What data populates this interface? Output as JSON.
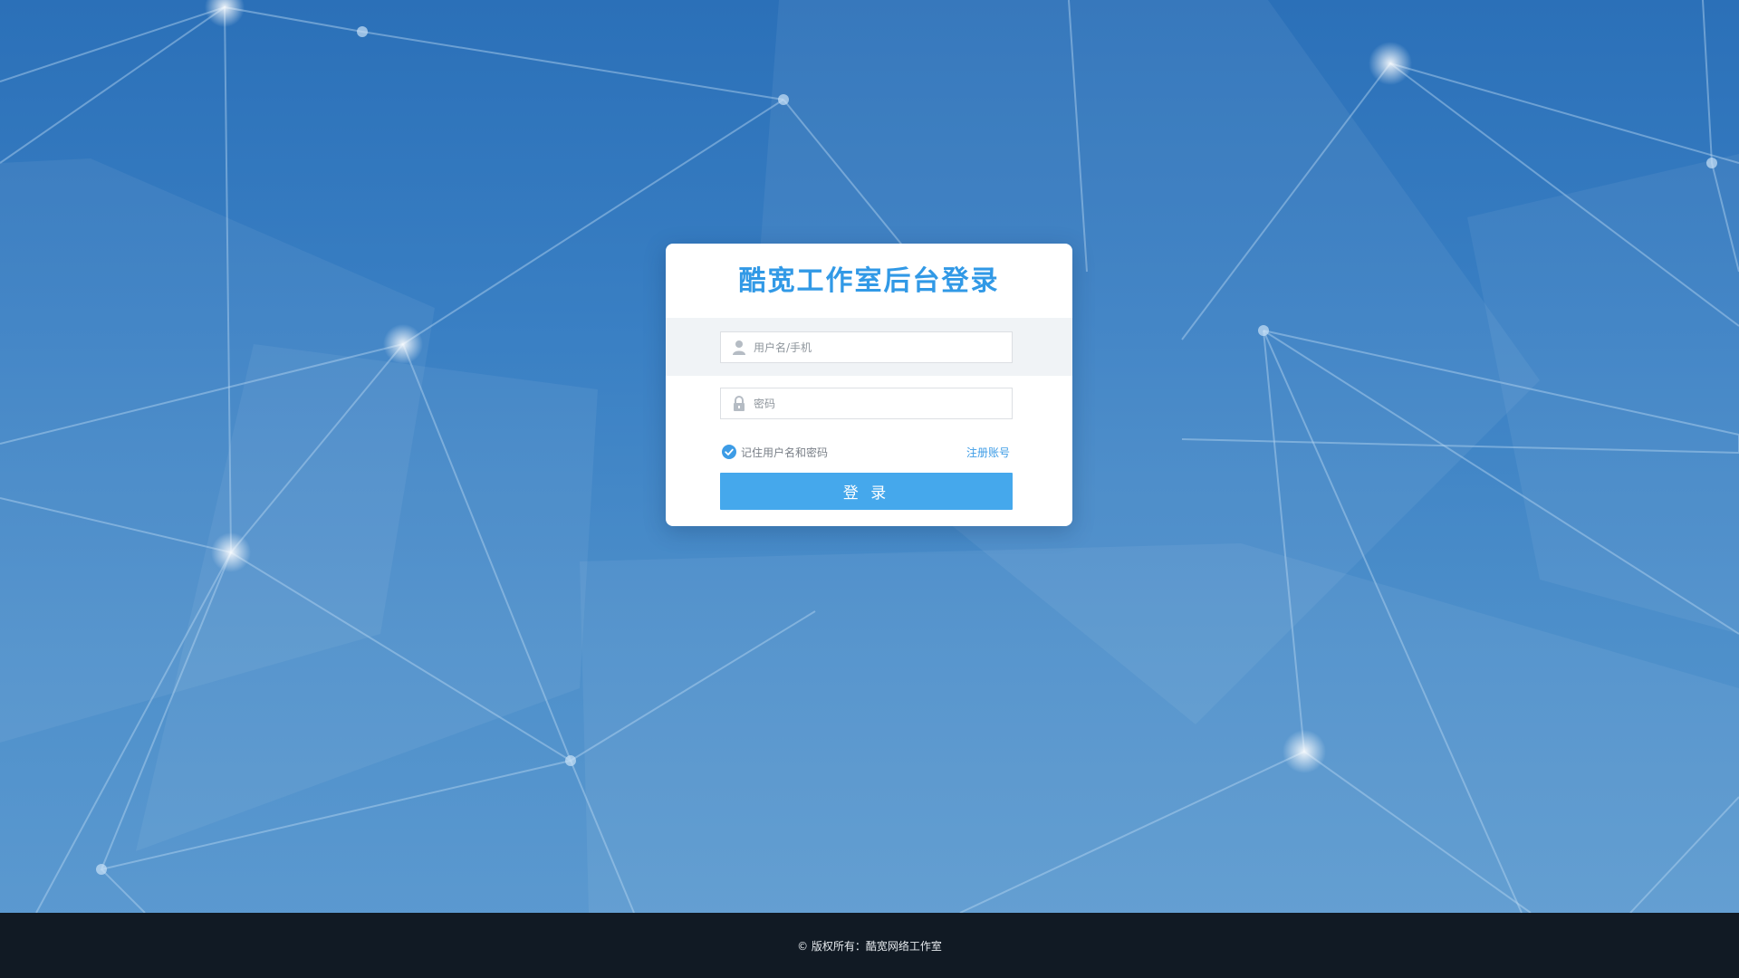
{
  "login": {
    "title": "酷宽工作室后台登录",
    "username_placeholder": "用户名/手机",
    "password_placeholder": "密码",
    "remember_label": "记住用户名和密码",
    "register_label": "注册账号",
    "login_button_label": "登 录",
    "remember_checked": true
  },
  "footer": {
    "copyright": "© 版权所有：酷宽网络工作室"
  },
  "icons": {
    "username": "user-icon",
    "password": "lock-icon",
    "remember": "checkmark-icon"
  },
  "colors": {
    "accent": "#45a8ec",
    "title": "#3199e6",
    "link": "#3d9ce6",
    "footer_bg": "#111a24",
    "background_top": "#2b70b8",
    "background_bottom": "#5e9bd1"
  }
}
